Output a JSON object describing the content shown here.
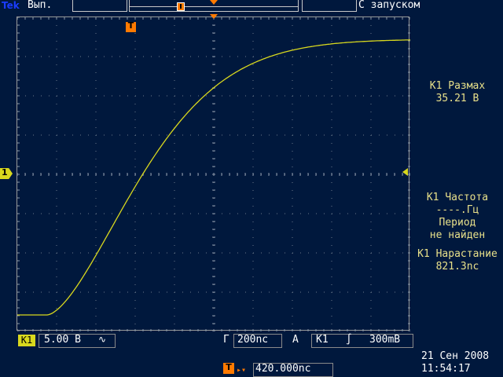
{
  "header": {
    "brand": "Tek",
    "run_status": "Вып.",
    "trigger_mode": "С запуском"
  },
  "markers": {
    "trigger_label": "T",
    "channel_label": "1"
  },
  "measurements": {
    "m1_title": "К1 Размах",
    "m1_value": "35.21 В",
    "m2_title": "К1 Частота",
    "m2_value": "----.Гц",
    "m3_title": "Период",
    "m3_value": "не найден",
    "m4_title": "К1 Нарастание",
    "m4_value": "821.3nс"
  },
  "footer": {
    "ch1_label": "K1",
    "ch1_scale": "5.00 В",
    "coupling_symbol": "∿",
    "timebase_prefix": "Г",
    "timebase_value": "200nс",
    "trigger_prefix": "A",
    "trigger_source": "K1",
    "trigger_slope_symbol": "∫",
    "trigger_level": "300mВ",
    "trigger_pos_value": "420.000nс",
    "date": "21 Сен  2008",
    "time": "11:54:17"
  },
  "colors": {
    "background": "#00183d",
    "trace": "#d8d81e",
    "trigger": "#ff7a00",
    "measurement_text": "#e8e08a"
  }
}
